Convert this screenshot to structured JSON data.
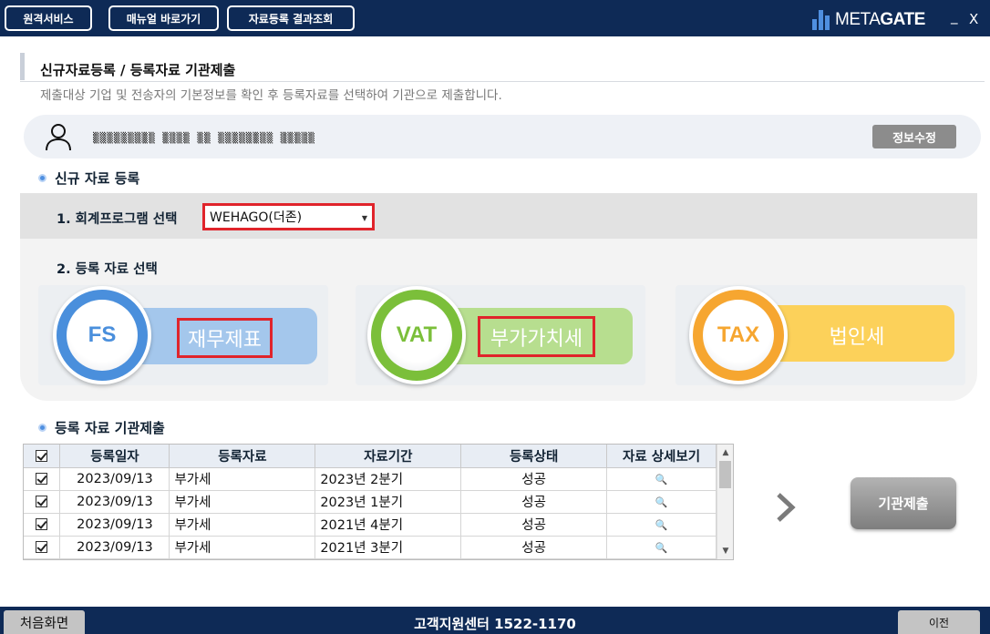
{
  "topbar": {
    "buttons": [
      "원격서비스",
      "매뉴얼 바로가기",
      "자료등록 결과조회"
    ],
    "logo_text_light": "META",
    "logo_text_bold": "GATE",
    "minimize": "_",
    "close": "X"
  },
  "header": {
    "title": "신규자료등록 / 등록자료 기관제출",
    "description": "제출대상 기업 및 전송자의 기본정보를 확인 후 등록자료를 선택하여 기관으로 제출합니다."
  },
  "user": {
    "info": "▒▒▒▒▒▒▒▒▒ ▒▒▒▒  ▒▒ ▒▒▒▒▒▒▒▒ ▒▒▒▒▒",
    "edit_button": "정보수정"
  },
  "register": {
    "section_title": "신규 자료 등록",
    "step1_label": "1. 회계프로그램 선택",
    "program_selected": "WEHAGO(더존)",
    "step2_label": "2. 등록 자료 선택",
    "cards": [
      {
        "code": "FS",
        "label": "재무제표",
        "color": "#4a8fdc",
        "pill": "#a4c7ec"
      },
      {
        "code": "VAT",
        "label": "부가가치세",
        "color": "#7bbf3a",
        "pill": "#b7de8f"
      },
      {
        "code": "TAX",
        "label": "법인세",
        "color": "#f6a630",
        "pill": "#fcd15a"
      }
    ]
  },
  "submission": {
    "section_title": "등록 자료 기관제출",
    "columns": [
      "등록일자",
      "등록자료",
      "자료기간",
      "등록상태",
      "자료 상세보기"
    ],
    "rows": [
      {
        "date": "2023/09/13",
        "type": "부가세",
        "period": "2023년 2분기",
        "status": "성공"
      },
      {
        "date": "2023/09/13",
        "type": "부가세",
        "period": "2023년 1분기",
        "status": "성공"
      },
      {
        "date": "2023/09/13",
        "type": "부가세",
        "period": "2021년 4분기",
        "status": "성공"
      },
      {
        "date": "2023/09/13",
        "type": "부가세",
        "period": "2021년 3분기",
        "status": "성공"
      }
    ],
    "submit_button": "기관제출"
  },
  "footer": {
    "home_button": "처음화면",
    "help_text": "고객지원센터 1522-1170",
    "prev_button": "이전"
  }
}
